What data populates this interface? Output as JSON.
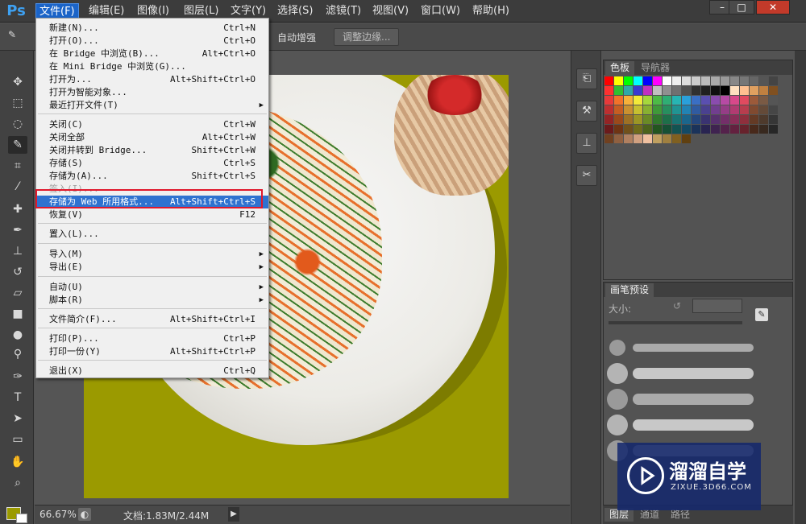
{
  "app": {
    "logo": "Ps"
  },
  "menubar": {
    "items": [
      "文件(F)",
      "编辑(E)",
      "图像(I)",
      "图层(L)",
      "文字(Y)",
      "选择(S)",
      "滤镜(T)",
      "视图(V)",
      "窗口(W)",
      "帮助(H)"
    ],
    "active": "文件(F)"
  },
  "window_controls": {
    "minimize": "–",
    "maximize": "□",
    "close": "✕"
  },
  "options_bar": {
    "auto_enhance": "自动增强",
    "refine_edge": "调整边缘..."
  },
  "file_menu": {
    "items": [
      {
        "label": "新建(N)...",
        "shortcut": "Ctrl+N"
      },
      {
        "label": "打开(O)...",
        "shortcut": "Ctrl+O"
      },
      {
        "label": "在 Bridge 中浏览(B)...",
        "shortcut": "Alt+Ctrl+O"
      },
      {
        "label": "在 Mini Bridge 中浏览(G)...",
        "shortcut": ""
      },
      {
        "label": "打开为...",
        "shortcut": "Alt+Shift+Ctrl+O"
      },
      {
        "label": "打开为智能对象...",
        "shortcut": ""
      },
      {
        "label": "最近打开文件(T)",
        "shortcut": "",
        "submenu": true
      },
      {
        "label": "关闭(C)",
        "shortcut": "Ctrl+W"
      },
      {
        "label": "关闭全部",
        "shortcut": "Alt+Ctrl+W"
      },
      {
        "label": "关闭并转到 Bridge...",
        "shortcut": "Shift+Ctrl+W"
      },
      {
        "label": "存储(S)",
        "shortcut": "Ctrl+S"
      },
      {
        "label": "存储为(A)...",
        "shortcut": "Shift+Ctrl+S"
      },
      {
        "label": "签入(I)...",
        "shortcut": "",
        "disabled": true
      },
      {
        "label": "存储为 Web 所用格式...",
        "shortcut": "Alt+Shift+Ctrl+S",
        "highlighted": true
      },
      {
        "label": "恢复(V)",
        "shortcut": "F12"
      },
      {
        "label": "置入(L)...",
        "shortcut": ""
      },
      {
        "label": "导入(M)",
        "shortcut": "",
        "submenu": true
      },
      {
        "label": "导出(E)",
        "shortcut": "",
        "submenu": true
      },
      {
        "label": "自动(U)",
        "shortcut": "",
        "submenu": true
      },
      {
        "label": "脚本(R)",
        "shortcut": "",
        "submenu": true
      },
      {
        "label": "文件简介(F)...",
        "shortcut": "Alt+Shift+Ctrl+I"
      },
      {
        "label": "打印(P)...",
        "shortcut": "Ctrl+P"
      },
      {
        "label": "打印一份(Y)",
        "shortcut": "Alt+Shift+Ctrl+P"
      },
      {
        "label": "退出(X)",
        "shortcut": "Ctrl+Q"
      }
    ]
  },
  "status_bar": {
    "zoom": "66.67%",
    "doc_size": "文档:1.83M/2.44M"
  },
  "swatches_panel": {
    "tabs": [
      "色板",
      "导航器"
    ]
  },
  "brush_panel": {
    "tab": "画笔预设",
    "size_label": "大小:"
  },
  "layers_panel": {
    "tabs": [
      "图层",
      "通道",
      "路径"
    ]
  },
  "colors": {
    "foreground": "#9b9a00",
    "background": "#ffffff",
    "menu_highlight": "#2f72d0",
    "annotation_box": "#e0182c"
  },
  "watermark": {
    "title": "溜溜自学",
    "url": "ZIXUE.3D66.COM"
  }
}
